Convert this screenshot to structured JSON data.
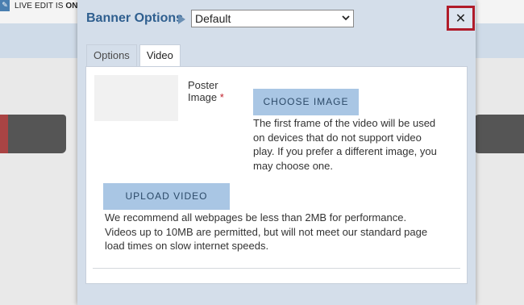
{
  "background": {
    "live_edit_label": "LIVE EDIT IS",
    "live_edit_state": "ON",
    "live_edit_icon": "edit-icon"
  },
  "modal": {
    "title": "Banner Options",
    "title_arrow_icon": "triangle-right-icon",
    "preset_select": {
      "value": "Default",
      "chevron_icon": "chevron-down-icon"
    },
    "close_label": "✕",
    "close_icon": "close-icon",
    "tabs": [
      {
        "label": "Options",
        "active": false
      },
      {
        "label": "Video",
        "active": true
      }
    ],
    "video_panel": {
      "poster_label": "Poster Image",
      "required_marker": "*",
      "choose_image_button": "CHOOSE IMAGE",
      "poster_help": "The first frame of the video will be used on devices that do not support video play. If you prefer a different image, you may choose one.",
      "upload_video_button": "UPLOAD VIDEO",
      "video_help": "We recommend all webpages be less than 2MB for performance. Videos up to 10MB are permitted, but will not meet our standard page load times on slow internet speeds."
    }
  },
  "colors": {
    "modal_bg": "#d4deea",
    "title_blue": "#2f5f8f",
    "button_bg": "#a9c6e4",
    "close_border": "#b01c2a",
    "required": "#c0202a"
  }
}
